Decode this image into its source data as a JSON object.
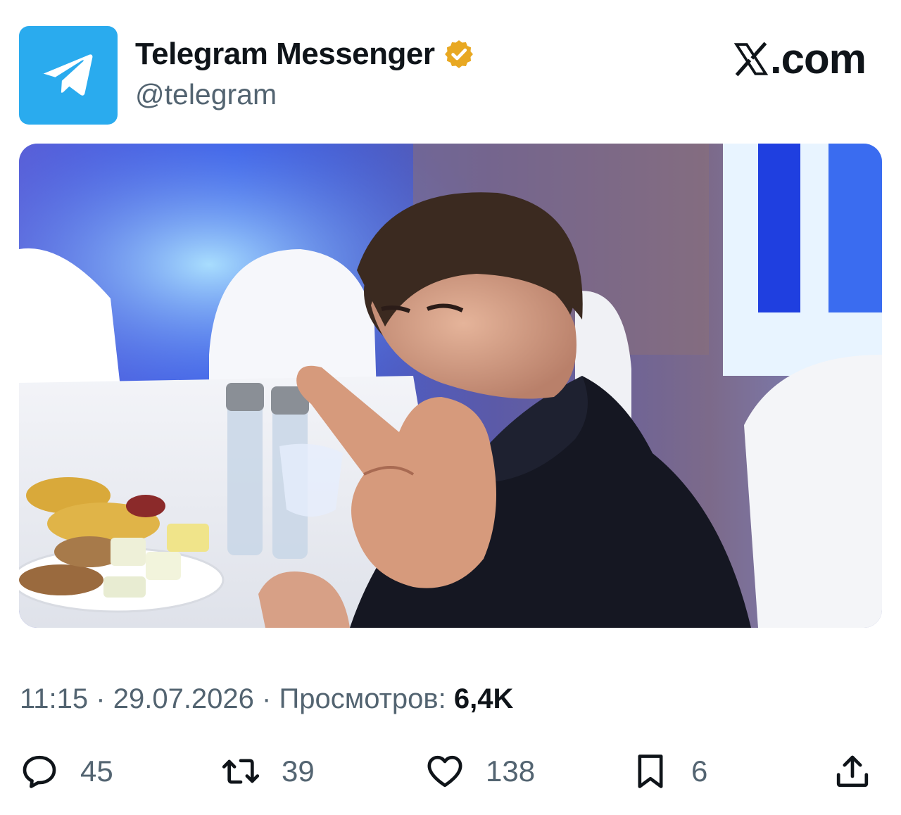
{
  "author": {
    "display_name": "Telegram Messenger",
    "handle": "@telegram",
    "verified": true,
    "avatar_icon": "telegram-paper-plane-icon",
    "avatar_color": "#2aabee",
    "verified_badge_color": "#e8a822"
  },
  "brand": {
    "icon": "x-logo-icon",
    "label": ".com"
  },
  "media": {
    "icon": "photo"
  },
  "meta": {
    "time": "11:15",
    "separator": "·",
    "date": "29.07.2026",
    "views_label": "Просмотров:",
    "views_count": "6,4K"
  },
  "actions": {
    "reply": {
      "icon": "reply-icon",
      "count": "45"
    },
    "retweet": {
      "icon": "retweet-icon",
      "count": "39"
    },
    "like": {
      "icon": "heart-icon",
      "count": "138"
    },
    "bookmark": {
      "icon": "bookmark-icon",
      "count": "6"
    },
    "share": {
      "icon": "share-icon"
    }
  },
  "colors": {
    "text_primary": "#0f1419",
    "text_secondary": "#536471"
  }
}
